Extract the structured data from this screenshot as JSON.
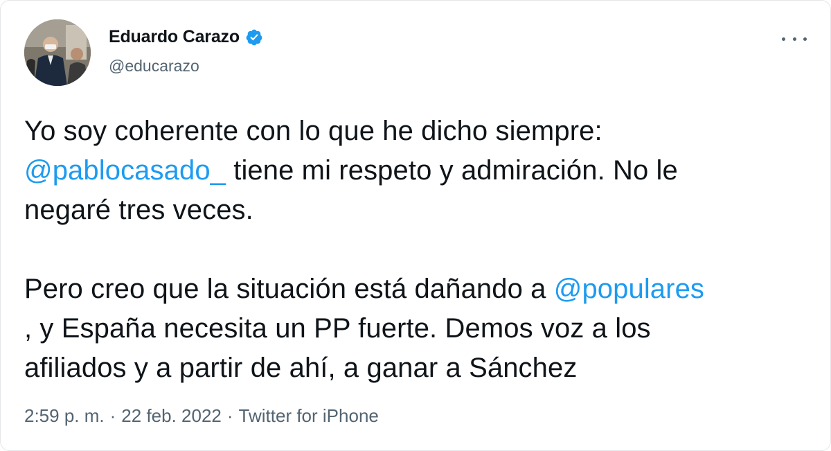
{
  "author": {
    "display_name": "Eduardo Carazo",
    "handle": "@educarazo",
    "verified": true,
    "avatar_icon": "profile-photo"
  },
  "menu_icon": "more-options-icon",
  "tweet": {
    "line1": "Yo soy coherente con lo que he dicho siempre:",
    "mention1": "@pablocasado_",
    "line2_rest": " tiene mi respeto y admiración. No le",
    "line3": "negaré tres veces.",
    "para2_start": "Pero creo que la situación está dañando a ",
    "mention2": "@populares",
    "para2_rest": ", y España necesita un PP fuerte. Demos voz a los",
    "para2_end": "afiliados y a partir de ahí, a ganar a Sánchez"
  },
  "meta": {
    "time": "2:59 p. m.",
    "separator": "·",
    "date": "22 feb. 2022",
    "source": "Twitter for iPhone"
  },
  "colors": {
    "link": "#1d9bf0",
    "text": "#0f1419",
    "secondary": "#536471"
  }
}
